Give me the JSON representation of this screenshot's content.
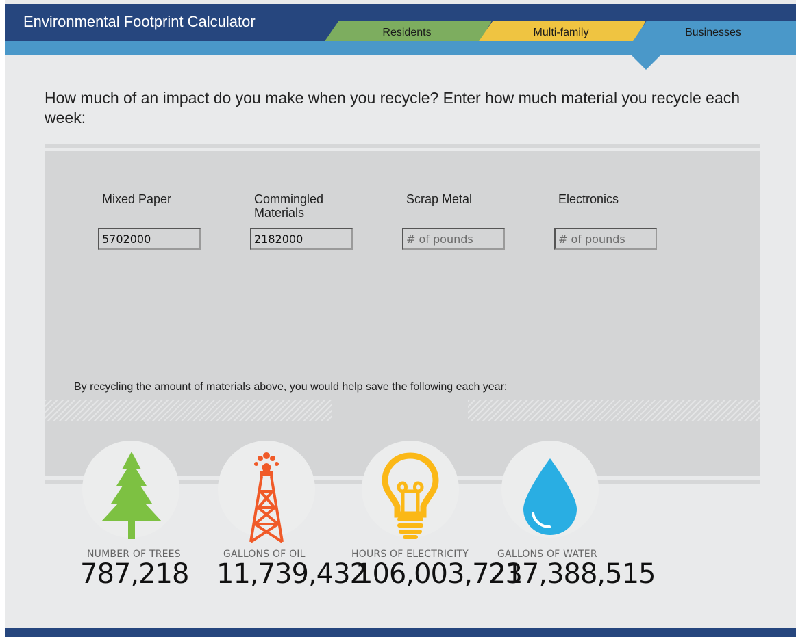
{
  "app": {
    "title": "Environmental Footprint Calculator"
  },
  "tabs": [
    {
      "label": "Residents"
    },
    {
      "label": "Multi-family"
    },
    {
      "label": "Businesses",
      "active": true
    }
  ],
  "question": "How much of an impact do you make when you recycle? Enter how much material you recycle each week:",
  "fields": [
    {
      "label": "Mixed Paper",
      "value": "5702000",
      "placeholder": ""
    },
    {
      "label": "Commingled Materials",
      "value": "2182000",
      "placeholder": ""
    },
    {
      "label": "Scrap Metal",
      "value": "",
      "placeholder": "# of pounds"
    },
    {
      "label": "Electronics",
      "value": "",
      "placeholder": "# of pounds"
    }
  ],
  "savings_text": "By recycling the amount of materials above, you would help save the following each year:",
  "stats": [
    {
      "label": "NUMBER OF TREES",
      "value": "787,218",
      "icon": "tree-icon"
    },
    {
      "label": "GALLONS OF OIL",
      "value": "11,739,432",
      "icon": "oil-derrick-icon"
    },
    {
      "label": "HOURS OF ELECTRICITY",
      "value": "106,003,721",
      "icon": "lightbulb-icon"
    },
    {
      "label": "GALLONS OF WATER",
      "value": "237,388,515",
      "icon": "water-drop-icon"
    }
  ],
  "colors": {
    "header": "#26467e",
    "band": "#4a98c9",
    "residents": "#7dad5f",
    "multifamily": "#efc441",
    "tree": "#7dc142",
    "oil": "#f05a28",
    "bulb": "#fbb817",
    "water": "#29aee3"
  }
}
